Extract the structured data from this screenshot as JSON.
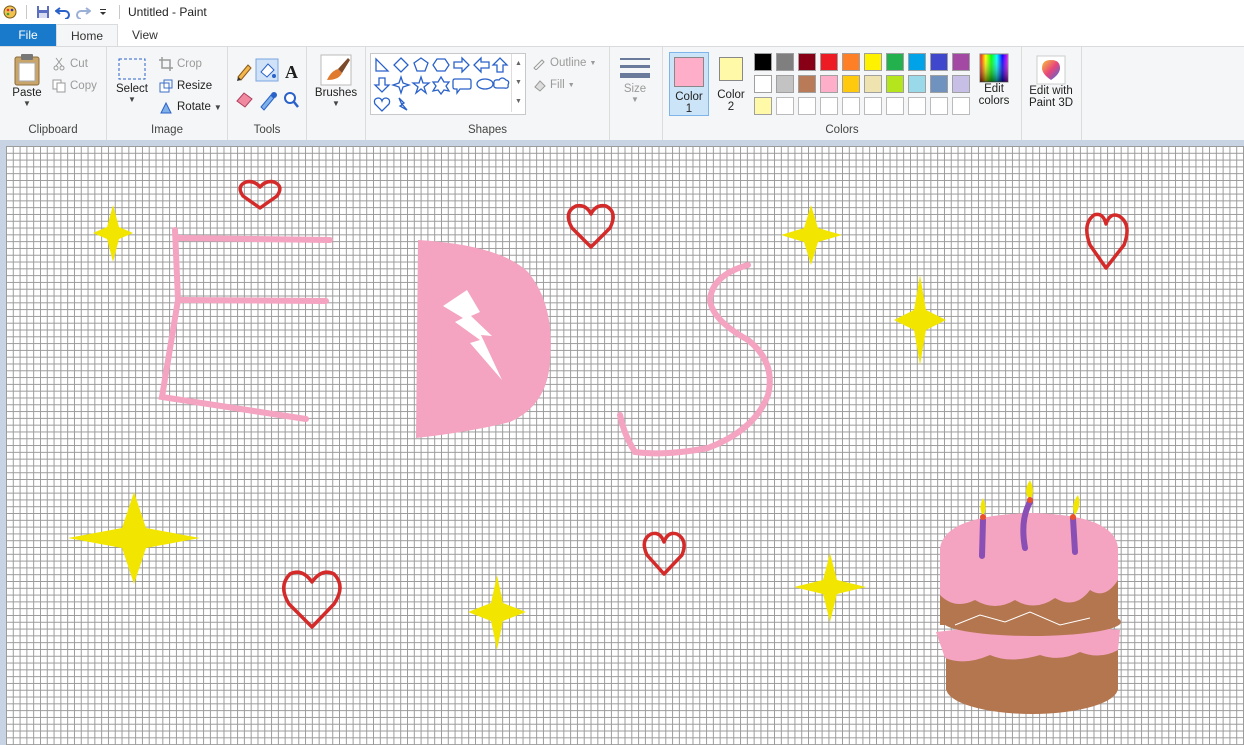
{
  "window": {
    "title": "Untitled - Paint"
  },
  "tabs": {
    "file": "File",
    "home": "Home",
    "view": "View"
  },
  "clipboard": {
    "label": "Clipboard",
    "paste": "Paste",
    "cut": "Cut",
    "copy": "Copy"
  },
  "image": {
    "label": "Image",
    "select": "Select",
    "crop": "Crop",
    "resize": "Resize",
    "rotate": "Rotate"
  },
  "tools": {
    "label": "Tools"
  },
  "brushes": {
    "label": "Brushes"
  },
  "shapes": {
    "label": "Shapes",
    "outline": "Outline",
    "fill": "Fill"
  },
  "size": {
    "label": "Size"
  },
  "colors": {
    "label": "Colors",
    "color1_label": "Color",
    "color1_num": "1",
    "color2_label": "Color",
    "color2_num": "2",
    "color1_value": "#ffaec9",
    "color2_value": "#fff9a8",
    "edit_colors_line1": "Edit",
    "edit_colors_line2": "colors",
    "palette_row1": [
      "#000000",
      "#7f7f7f",
      "#880015",
      "#ed1c24",
      "#ff7f27",
      "#fff200",
      "#22b14c",
      "#00a2e8",
      "#3f48cc",
      "#a349a4"
    ],
    "palette_row2": [
      "#ffffff",
      "#c3c3c3",
      "#b97a57",
      "#ffaec9",
      "#ffc90e",
      "#efe4b0",
      "#b5e61d",
      "#99d9ea",
      "#7092be",
      "#c8bfe7"
    ],
    "palette_row3": [
      "#fff9a8",
      "",
      "",
      "",
      "",
      "",
      "",
      "",
      "",
      ""
    ]
  },
  "paint3d": {
    "line1": "Edit with",
    "line2": "Paint 3D"
  },
  "drawing": {
    "pink": "#f4a3c0",
    "yellow": "#f2e600",
    "red": "#d42a2a",
    "cake_brown": "#b4764f",
    "candle_purple": "#8a4fb5"
  }
}
